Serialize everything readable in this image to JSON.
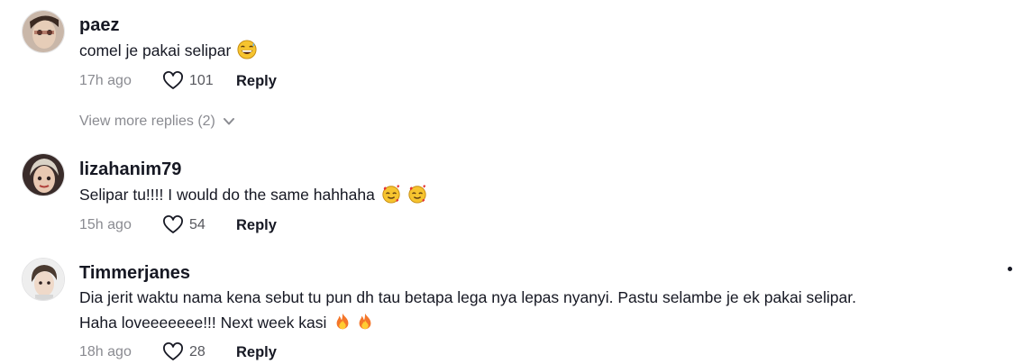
{
  "comments": [
    {
      "username": "paez",
      "text": "comel je pakai selipar",
      "time": "17h ago",
      "likes": "101",
      "reply_label": "Reply"
    },
    {
      "username": "lizahanim79",
      "text": "Selipar tu!!!! I would do the same hahhaha",
      "time": "15h ago",
      "likes": "54",
      "reply_label": "Reply"
    },
    {
      "username": "Timmerjanes",
      "text_line1": "Dia jerit waktu nama kena sebut tu pun dh tau betapa lega nya lepas nyanyi. Pastu selambe je ek pakai selipar.",
      "text_line2": "Haha loveeeeeee!!! Next week kasi",
      "time": "18h ago",
      "likes": "28",
      "reply_label": "Reply"
    }
  ],
  "view_more_replies": "View more replies (2)",
  "icons": {
    "heart": "heart-outline-icon",
    "chevron": "chevron-down-icon",
    "emoji_1": "grinning-sweat-emoji",
    "emoji_2": "smiling-hearts-emoji",
    "emoji_3": "fire-emoji"
  }
}
